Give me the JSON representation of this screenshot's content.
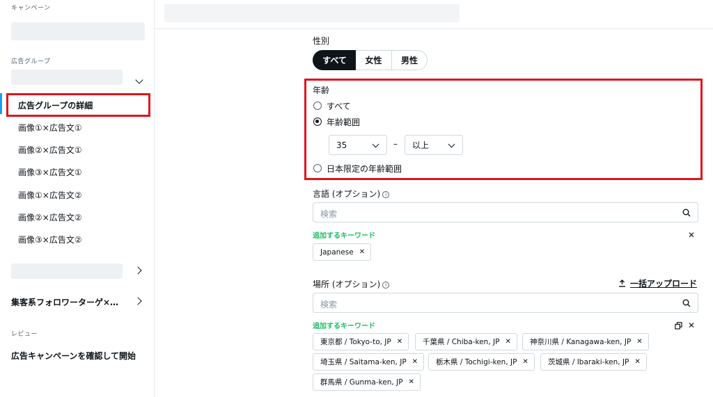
{
  "sidebar": {
    "campaign_label": "キャンペーン",
    "adgroup_label": "広告グループ",
    "selected_item": "広告グループの詳細",
    "ads": [
      "画像①×広告文①",
      "画像②×広告文①",
      "画像③×広告文①",
      "画像①×広告文②",
      "画像②×広告文②",
      "画像③×広告文②"
    ],
    "follower_group": "集客系フォロワーターゲ×…",
    "review_label": "レビュー",
    "review_item": "広告キャンペーンを確認して開始"
  },
  "gender": {
    "label": "性別",
    "options": [
      "すべて",
      "女性",
      "男性"
    ],
    "selected": "すべて"
  },
  "age": {
    "label": "年齢",
    "options": [
      "すべて",
      "年齢範囲",
      "日本限定の年齢範囲"
    ],
    "selected": "年齢範囲",
    "min": "35",
    "separator": "–",
    "max": "以上"
  },
  "language": {
    "label": "言語 (オプション)",
    "placeholder": "検索",
    "added_label": "追加するキーワード",
    "chips": [
      "Japanese"
    ]
  },
  "location": {
    "label": "場所 (オプション)",
    "upload": "一括アップロード",
    "placeholder": "検索",
    "added_label": "追加するキーワード",
    "chips": [
      "東京都 / Tokyo-to, JP",
      "千葉県 / Chiba-ken, JP",
      "神奈川県 / Kanagawa-ken, JP",
      "埼玉県 / Saitama-ken, JP",
      "栃木県 / Tochigi-ken, JP",
      "茨城県 / Ibaraki-ken, JP",
      "群馬県 / Gunma-ken, JP"
    ]
  },
  "colors": {
    "highlight": "#e0141e",
    "keyword_green": "#17bf63",
    "active_segment": "#0f1419"
  }
}
